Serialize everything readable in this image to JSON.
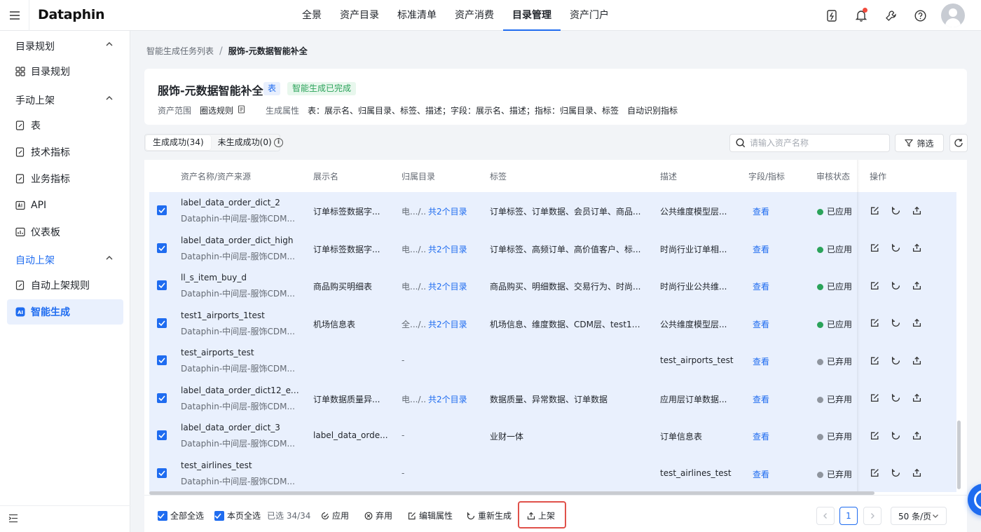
{
  "app": {
    "logo": "Dataphin"
  },
  "nav": [
    "全景",
    "资产目录",
    "标准清单",
    "资产消费",
    "目录管理",
    "资产门户"
  ],
  "sidebar": {
    "groups": [
      {
        "label": "目录规划"
      },
      {
        "label": "手动上架"
      },
      {
        "label": "自动上架"
      }
    ],
    "items": [
      {
        "label": "目录规划"
      },
      {
        "label": "表"
      },
      {
        "label": "技术指标"
      },
      {
        "label": "业务指标"
      },
      {
        "label": "API"
      },
      {
        "label": "仪表板"
      },
      {
        "label": "自动上架规则"
      },
      {
        "label": "智能生成"
      }
    ]
  },
  "breadcrumb": {
    "parent": "智能生成任务列表",
    "current": "服饰-元数据智能补全"
  },
  "header": {
    "title": "服饰-元数据智能补全",
    "type_tag": "表",
    "status_tag": "智能生成已完成",
    "scope_label": "资产范围",
    "scope_rule": "圈选规则",
    "attr_label": "生成属性",
    "attr_value": "表：展示名、归属目录、标签、描述；字段：展示名、描述；指标：归属目录、标签",
    "auto_label": "自动识别指标"
  },
  "tabs": [
    "生成成功(34)",
    "未生成成功(0)"
  ],
  "search": {
    "placeholder": "请输入资产名称"
  },
  "filter_label": "筛选",
  "columns": [
    "资产名称/资产来源",
    "展示名",
    "归属目录",
    "标签",
    "描述",
    "字段/指标",
    "审核状态",
    "操作"
  ],
  "rows": [
    {
      "name": "label_data_order_dict_2",
      "source": "Dataphin-中间层-服饰CDM...",
      "display": "订单标签数据字...",
      "dir": "电.../..",
      "dir_link": "共2个目录",
      "tags": "订单标签、订单数据、会员订单、商品...",
      "desc": "公共维度模型层...",
      "view": "查看",
      "status": "已应用"
    },
    {
      "name": "label_data_order_dict_high",
      "source": "Dataphin-中间层-服饰CDM...",
      "display": "订单标签数据字...",
      "dir": "电.../..",
      "dir_link": "共2个目录",
      "tags": "订单标签、高频订单、高价值客户、标...",
      "desc": "时尚行业订单相...",
      "view": "查看",
      "status": "已应用"
    },
    {
      "name": "ll_s_item_buy_d",
      "source": "Dataphin-中间层-服饰CDM...",
      "display": "商品购买明细表",
      "dir": "电.../..",
      "dir_link": "共2个目录",
      "tags": "商品购买、明细数据、交易行为、时尚...",
      "desc": "时尚行业公共维...",
      "view": "查看",
      "status": "已应用"
    },
    {
      "name": "test1_airports_1test",
      "source": "Dataphin-中间层-服饰CDM...",
      "display": "机场信息表",
      "dir": "全.../..",
      "dir_link": "共2个目录",
      "tags": "机场信息、维度数据、CDM层、test1_a...",
      "desc": "公共维度模型层...",
      "view": "查看",
      "status": "已应用"
    },
    {
      "name": "test_airports_test",
      "source": "Dataphin-中间层-服饰CDM...",
      "display": "",
      "dir": "-",
      "dir_link": "",
      "tags": "",
      "desc": "test_airports_test",
      "view": "查看",
      "status": "已弃用"
    },
    {
      "name": "label_data_order_dict12_exc...",
      "source": "Dataphin-中间层-服饰CDM...",
      "display": "订单数据质量异...",
      "dir": "电.../..",
      "dir_link": "共2个目录",
      "tags": "数据质量、异常数据、订单数据",
      "desc": "应用层订单数据...",
      "view": "查看",
      "status": "已弃用"
    },
    {
      "name": "label_data_order_dict_3",
      "source": "Dataphin-中间层-服饰CDM...",
      "display": "label_data_orde...",
      "dir": "-",
      "dir_link": "",
      "tags": "业财一体",
      "desc": "订单信息表",
      "view": "查看",
      "status": "已弃用"
    },
    {
      "name": "test_airlines_test",
      "source": "Dataphin-中间层-服饰CDM...",
      "display": "",
      "dir": "-",
      "dir_link": "",
      "tags": "",
      "desc": "test_airlines_test",
      "view": "查看",
      "status": "已弃用"
    }
  ],
  "footer": {
    "select_all": "全部全选",
    "select_page": "本页全选",
    "selected": "已选 34/34",
    "apply": "应用",
    "discard": "弃用",
    "edit_attr": "编辑属性",
    "regenerate": "重新生成",
    "publish": "上架"
  },
  "pagination": {
    "current": "1",
    "page_size": "50 条/页"
  },
  "colors": {
    "primary": "#1f6cf0",
    "row_selected": "#e9f0fd",
    "success": "#2ba35a",
    "muted": "#8f959e",
    "highlight": "#e0514a"
  }
}
